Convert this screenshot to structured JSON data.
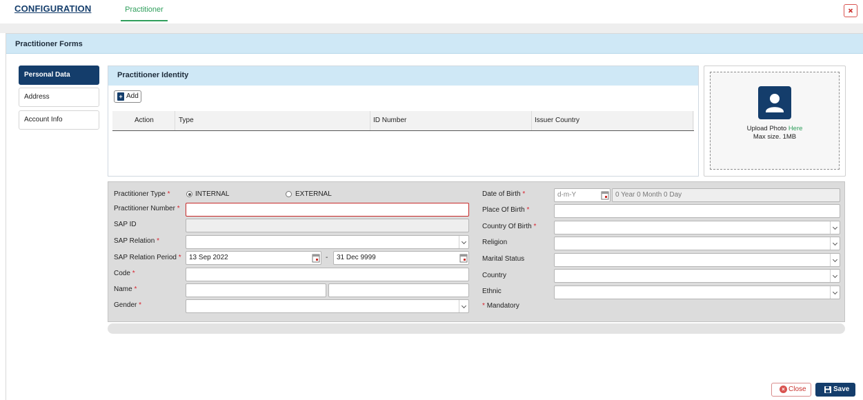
{
  "header": {
    "app_title": "CONFIGURATION",
    "active_tab": "Practitioner",
    "close_icon": "close-x-icon",
    "accent_color": "#143d6b",
    "tab_color": "#2e9e5b"
  },
  "forms": {
    "title": "Practitioner Forms",
    "nav": [
      "Personal Data",
      "Address",
      "Account Info"
    ],
    "active_nav": "Personal Data"
  },
  "identity": {
    "title": "Practitioner Identity",
    "add_label": "Add",
    "columns": [
      "Action",
      "Type",
      "ID Number",
      "Issuer Country"
    ],
    "rows": []
  },
  "photo": {
    "upload_text": "Upload Photo",
    "upload_link": "Here",
    "max_size": "Max size. 1MB"
  },
  "form": {
    "practitioner_type": {
      "label": "Practitioner Type",
      "options": [
        "INTERNAL",
        "EXTERNAL"
      ],
      "selected": "INTERNAL"
    },
    "practitioner_number": {
      "label": "Practitioner Number",
      "value": ""
    },
    "sap_id": {
      "label": "SAP ID",
      "value": ""
    },
    "sap_relation": {
      "label": "SAP Relation",
      "value": ""
    },
    "sap_relation_period": {
      "label": "SAP Relation Period",
      "from": "13 Sep 2022",
      "separator": "-",
      "to": "31 Dec 9999"
    },
    "code": {
      "label": "Code",
      "value": ""
    },
    "name": {
      "label": "Name",
      "first": "",
      "last": ""
    },
    "gender": {
      "label": "Gender",
      "value": ""
    },
    "date_of_birth": {
      "label": "Date of Birth",
      "placeholder": "d-m-Y",
      "age": "0 Year 0 Month 0 Day"
    },
    "place_of_birth": {
      "label": "Place Of Birth",
      "value": ""
    },
    "country_of_birth": {
      "label": "Country Of Birth",
      "value": ""
    },
    "religion": {
      "label": "Religion",
      "value": ""
    },
    "marital_status": {
      "label": "Marital Status",
      "value": ""
    },
    "country": {
      "label": "Country",
      "value": ""
    },
    "ethnic": {
      "label": "Ethnic",
      "value": ""
    },
    "mandatory_note": "Mandatory",
    "required_mark": "*"
  },
  "footer": {
    "close_label": "Close",
    "save_label": "Save"
  }
}
